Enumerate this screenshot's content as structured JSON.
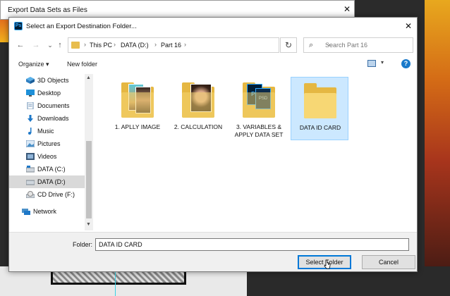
{
  "outer_dialog": {
    "title": "Export Data Sets as Files",
    "close": "✕"
  },
  "dialog": {
    "title": "Select an Export Destination Folder...",
    "app_icon": "Ps",
    "close": "✕"
  },
  "nav": {
    "back": "←",
    "forward": "→",
    "recent": "⌄",
    "up": "↑",
    "breadcrumbs": [
      "This PC",
      "DATA (D:)",
      "Part 16"
    ],
    "refresh": "↻",
    "search_placeholder": "Search Part 16"
  },
  "command_bar": {
    "organize": "Organize ▾",
    "new_folder": "New folder",
    "help": "?"
  },
  "sidebar": {
    "items": [
      {
        "label": "3D Objects",
        "icon": "cube-icon"
      },
      {
        "label": "Desktop",
        "icon": "desktop-icon"
      },
      {
        "label": "Documents",
        "icon": "documents-icon"
      },
      {
        "label": "Downloads",
        "icon": "download-icon"
      },
      {
        "label": "Music",
        "icon": "music-icon"
      },
      {
        "label": "Pictures",
        "icon": "pictures-icon"
      },
      {
        "label": "Videos",
        "icon": "videos-icon"
      },
      {
        "label": "DATA (C:)",
        "icon": "drive-icon"
      },
      {
        "label": "DATA (D:)",
        "icon": "drive-icon",
        "selected": true
      },
      {
        "label": "CD Drive (F:)",
        "icon": "cd-icon"
      },
      {
        "label": "Network",
        "icon": "network-icon"
      }
    ]
  },
  "folders": [
    {
      "line1": "1. APLLY IMAGE",
      "line2": "",
      "selected": false
    },
    {
      "line1": "2. CALCULATION",
      "line2": "",
      "selected": false
    },
    {
      "line1": "3. VARIABLES &",
      "line2": "APPLY DATA SET",
      "selected": false
    },
    {
      "line1": "DATA ID CARD",
      "line2": "",
      "selected": true
    }
  ],
  "bottom": {
    "folder_label": "Folder:",
    "folder_value": "DATA ID CARD",
    "select_button": "Select Folder",
    "cancel_button": "Cancel"
  },
  "colors": {
    "accent": "#0078d7",
    "folder": "#f7d774",
    "selection": "#cce8ff"
  }
}
